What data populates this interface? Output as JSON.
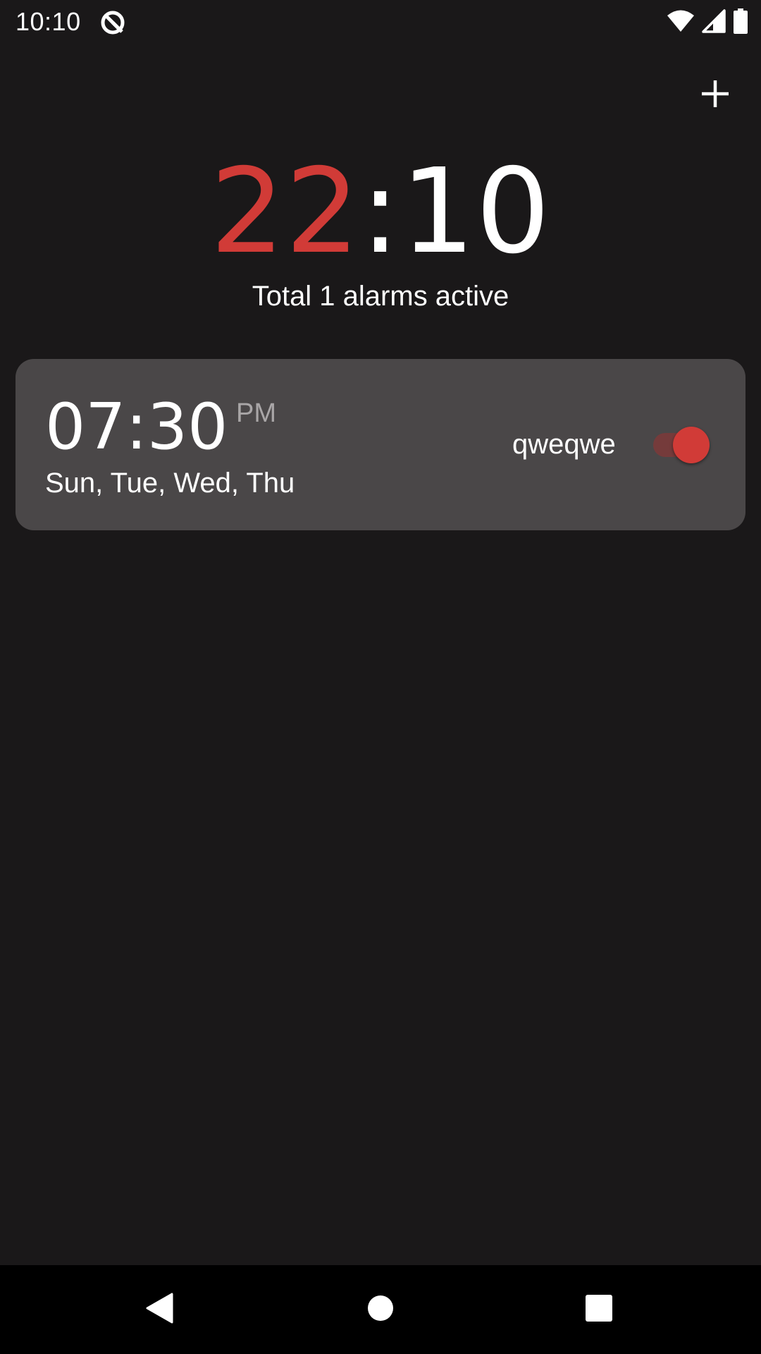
{
  "status_bar": {
    "time": "10:10",
    "app_icon": "no-tracking-icon",
    "icons": [
      "wifi-icon",
      "cell-signal-icon",
      "battery-icon"
    ]
  },
  "header": {
    "add_icon": "plus-icon"
  },
  "clock": {
    "hours": "22",
    "separator": ":",
    "minutes": "10",
    "hours_color": "#d13b37"
  },
  "summary": {
    "text": "Total 1 alarms active"
  },
  "alarms": [
    {
      "time": "07:30",
      "ampm": "PM",
      "days": "Sun, Tue, Wed, Thu",
      "label": "qweqwe",
      "enabled": true
    }
  ],
  "nav_bar": {
    "icons": [
      "back-icon",
      "home-icon",
      "recents-icon"
    ]
  },
  "colors": {
    "background": "#1a1819",
    "card": "#4a4748",
    "accent": "#d13b37",
    "nav_background": "#000000"
  }
}
